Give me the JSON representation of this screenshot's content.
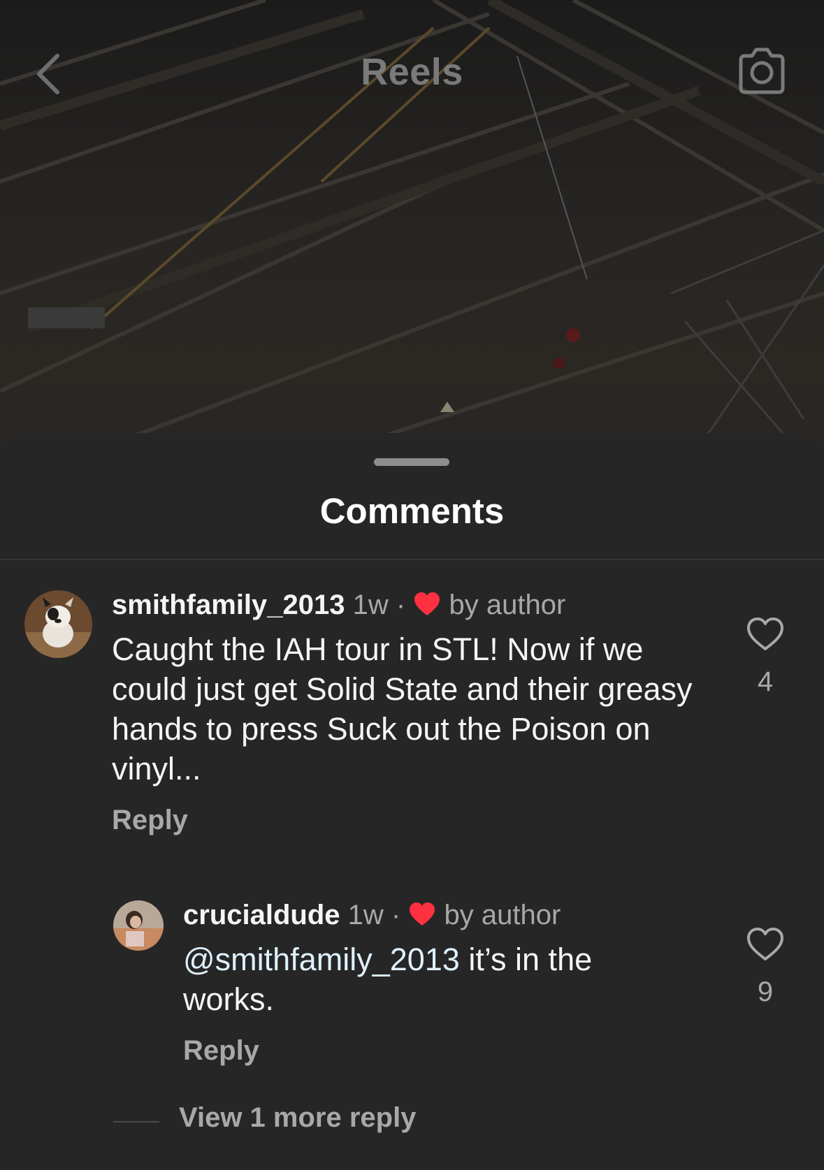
{
  "header": {
    "title": "Reels",
    "back_icon": "chevron-left-icon",
    "camera_icon": "camera-icon"
  },
  "sheet": {
    "title": "Comments"
  },
  "comments": [
    {
      "username": "smithfamily_2013",
      "time": "1w",
      "separator": "·",
      "liked_by": "by author",
      "text": "Caught the IAH tour in STL! Now if we could just get Solid State and their greasy hands to press Suck out the Poison on vinyl...",
      "reply_label": "Reply",
      "likes": "4"
    },
    {
      "username": "crucialdude",
      "time": "1w",
      "separator": "·",
      "liked_by": "by author",
      "mention": "@smithfamily_2013",
      "text": " it’s in the works.",
      "reply_label": "Reply",
      "likes": "9"
    }
  ],
  "view_more": "View 1 more reply",
  "colors": {
    "sheet_bg": "#262626",
    "heart_red": "#ff3040",
    "muted_text": "#a8a8a8",
    "mention": "#e0f1ff"
  }
}
